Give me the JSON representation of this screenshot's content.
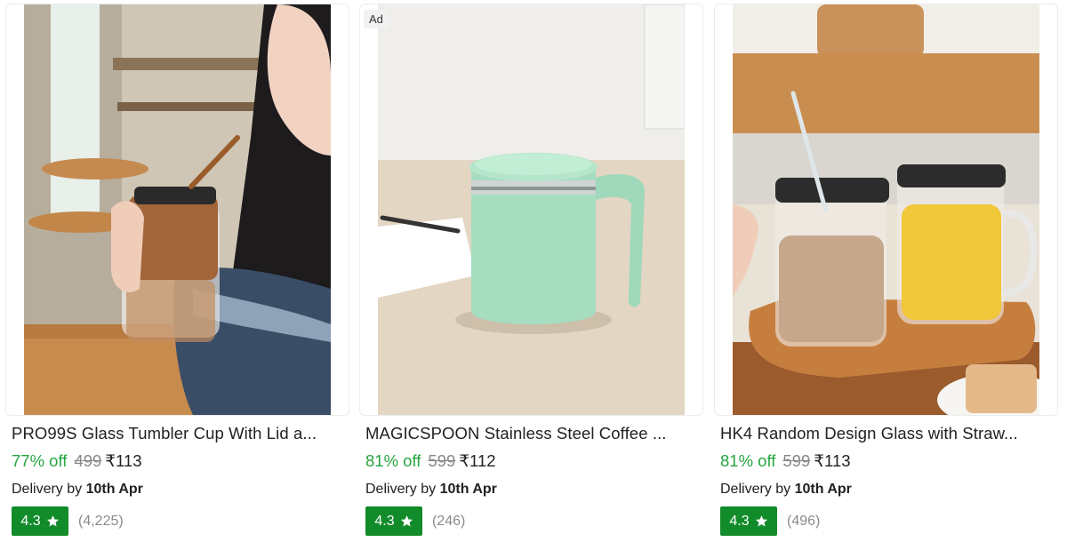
{
  "products": [
    {
      "title": "PRO99S Glass Tumbler Cup With Lid a...",
      "discount": "77% off",
      "mrp": "499",
      "price": "₹113",
      "delivery_prefix": "Delivery by",
      "delivery_date": "10th Apr",
      "rating": "4.3",
      "rating_count": "(4,225)",
      "image": "woman-sipping-tan-leather-tumbler"
    },
    {
      "ad_label": "Ad",
      "title": "MAGICSPOON Stainless Steel Coffee ...",
      "discount": "81% off",
      "mrp": "599",
      "price": "₹112",
      "delivery_prefix": "Delivery by",
      "delivery_date": "10th Apr",
      "rating": "4.3",
      "rating_count": "(246)",
      "image": "mint-green-steel-mug-on-desk"
    },
    {
      "title": "HK4 Random Design Glass with Straw...",
      "discount": "81% off",
      "mrp": "599",
      "price": "₹113",
      "delivery_prefix": "Delivery by",
      "delivery_date": "10th Apr",
      "rating": "4.3",
      "rating_count": "(496)",
      "image": "two-printed-glass-mugs-on-tray"
    }
  ],
  "colors": {
    "discount_green": "#26a541",
    "rating_badge_green": "#128b2b",
    "muted_gray": "#878787"
  },
  "icons": [
    "star-icon"
  ]
}
